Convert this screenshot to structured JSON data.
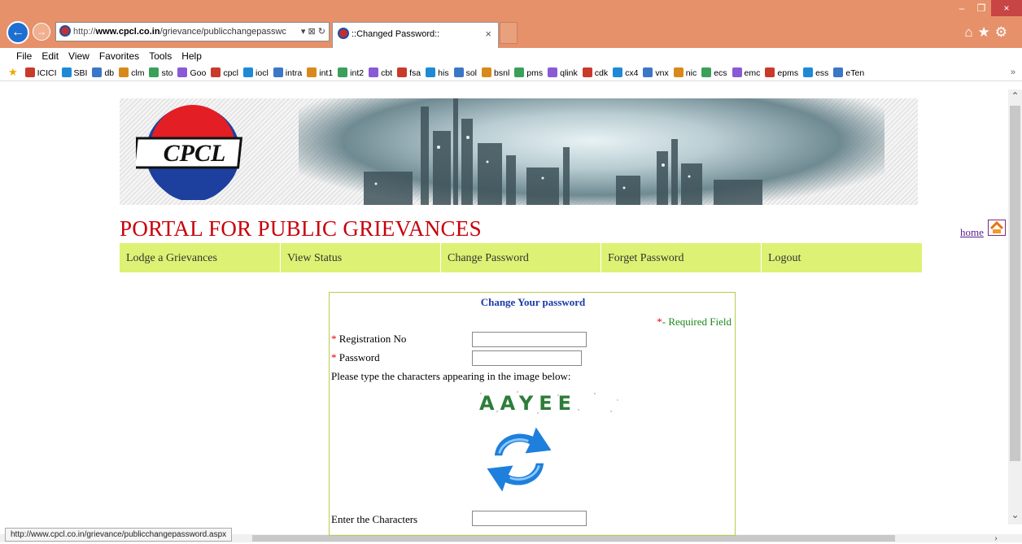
{
  "browser": {
    "address_scheme": "http://",
    "address_host": "www.cpcl.co.in",
    "address_path": "/grievance/publicchangepasswc",
    "address_actions": "▾ ⊠ ↻",
    "tab_title": "::Changed Password::",
    "tab_close": "×",
    "window_controls": [
      "–",
      "❐",
      "×"
    ],
    "toolbar_icons": "⌂★⚙",
    "menu": [
      "File",
      "Edit",
      "View",
      "Favorites",
      "Tools",
      "Help"
    ],
    "favorites": [
      "ICICI",
      "SBI",
      "db",
      "clm",
      "sto",
      "Goo",
      "cpcl",
      "iocl",
      "intra",
      "int1",
      "int2",
      "cbt",
      "fsa",
      "his",
      "sol",
      "bsnl",
      "pms",
      "qlink",
      "cdk",
      "cx4",
      "vnx",
      "nic",
      "ecs",
      "emc",
      "epms",
      "ess",
      "eTen"
    ],
    "favorites_more": "»",
    "status_url": "http://www.cpcl.co.in/grievance/publicchangepassword.aspx"
  },
  "header": {
    "logo_text": "CPCL",
    "portal_title": "PORTAL FOR PUBLIC GRIEVANCES",
    "home_link": "home"
  },
  "nav": {
    "items": [
      "Lodge a Grievances",
      "View Status",
      "Change Password",
      "Forget Password",
      "Logout"
    ]
  },
  "form": {
    "title": "Change Your password",
    "required_star": "*",
    "required_note": "- Required Field",
    "registration_label": "Registration No",
    "password_label": "Password",
    "captcha_hint": "Please type the characters appearing in the image below:",
    "captcha_text": "AAYEE",
    "enter_chars_label": "Enter the Characters"
  },
  "colors": {
    "chrome": "#e6916a",
    "title_red": "#c8000a",
    "nav_bg": "#ddf274",
    "form_title_blue": "#1a3aa8",
    "required_green": "#1a8a1a",
    "captcha_green": "#2f7d3a"
  }
}
